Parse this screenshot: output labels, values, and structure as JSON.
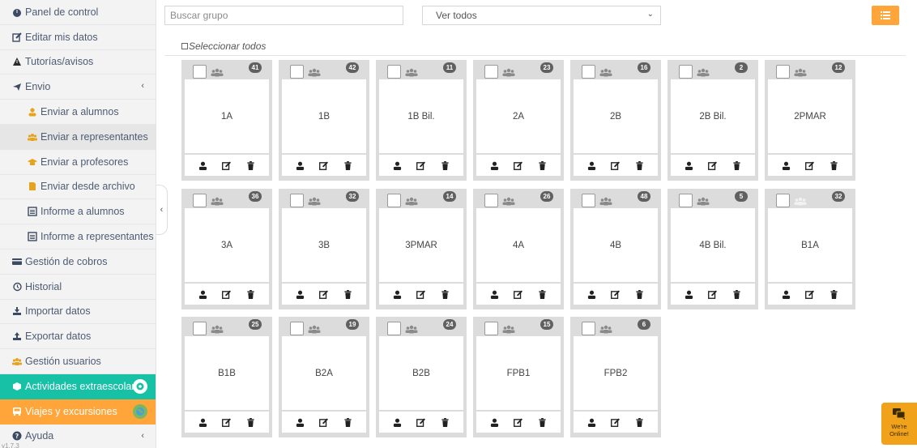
{
  "sidebar": {
    "items": [
      {
        "label": "Panel de control",
        "icon": "dashboard-icon",
        "name": "sidebar-item-panel-control"
      },
      {
        "label": "Editar mis datos",
        "icon": "edit-icon",
        "name": "sidebar-item-editar-datos"
      },
      {
        "label": "Tutorías/avisos",
        "icon": "warning-icon",
        "name": "sidebar-item-tutorias"
      },
      {
        "label": "Envio",
        "icon": "send-icon",
        "name": "sidebar-item-envio",
        "caret": "‹"
      },
      {
        "label": "Enviar a alumnos",
        "icon": "user-icon",
        "name": "sidebar-item-enviar-alumnos",
        "sub": true
      },
      {
        "label": "Enviar a representantes",
        "icon": "users-icon",
        "name": "sidebar-item-enviar-representantes",
        "sub": true,
        "active": true
      },
      {
        "label": "Enviar a profesores",
        "icon": "graduation-cap-icon",
        "name": "sidebar-item-enviar-profesores",
        "sub": true
      },
      {
        "label": "Enviar desde archivo",
        "icon": "file-icon",
        "name": "sidebar-item-enviar-archivo",
        "sub": true
      },
      {
        "label": "Informe a alumnos",
        "icon": "list-alt-icon",
        "name": "sidebar-item-informe-alumnos",
        "sub": true
      },
      {
        "label": "Informe a representantes",
        "icon": "list-alt-icon",
        "name": "sidebar-item-informe-representantes",
        "sub": true
      },
      {
        "label": "Gestión de cobros",
        "icon": "credit-card-icon",
        "name": "sidebar-item-gestion-cobros"
      },
      {
        "label": "Historial",
        "icon": "history-icon",
        "name": "sidebar-item-historial"
      },
      {
        "label": "Importar datos",
        "icon": "import-icon",
        "name": "sidebar-item-importar"
      },
      {
        "label": "Exportar datos",
        "icon": "export-icon",
        "name": "sidebar-item-exportar"
      },
      {
        "label": "Gestión usuarios",
        "icon": "users-icon",
        "name": "sidebar-item-gestion-usuarios"
      },
      {
        "label": "Actividades extraescolares",
        "icon": "cube-icon",
        "name": "sidebar-item-actividades",
        "style": "green"
      },
      {
        "label": "Viajes y excursiones",
        "icon": "bus-icon",
        "name": "sidebar-item-viajes",
        "style": "orange"
      },
      {
        "label": "Ayuda",
        "icon": "help-icon",
        "name": "sidebar-item-ayuda",
        "caret": "‹"
      }
    ],
    "version": "v1.7.3"
  },
  "search": {
    "placeholder": "Buscar grupo"
  },
  "filter": {
    "selected": "Ver todos"
  },
  "select_all_label": "Seleccionar todos",
  "groups": [
    {
      "name": "1A",
      "count": "41"
    },
    {
      "name": "1B",
      "count": "42"
    },
    {
      "name": "1B Bil.",
      "count": "11"
    },
    {
      "name": "2A",
      "count": "23"
    },
    {
      "name": "2B",
      "count": "16"
    },
    {
      "name": "2B Bil.",
      "count": "2"
    },
    {
      "name": "2PMAR",
      "count": "12"
    },
    {
      "name": "3A",
      "count": "36"
    },
    {
      "name": "3B",
      "count": "32"
    },
    {
      "name": "3PMAR",
      "count": "14"
    },
    {
      "name": "4A",
      "count": "26"
    },
    {
      "name": "4B",
      "count": "48"
    },
    {
      "name": "4B Bil.",
      "count": "5"
    },
    {
      "name": "B1A",
      "count": "32"
    },
    {
      "name": "B1B",
      "count": "25"
    },
    {
      "name": "B2A",
      "count": "19"
    },
    {
      "name": "B2B",
      "count": "24"
    },
    {
      "name": "FPB1",
      "count": "15"
    },
    {
      "name": "FPB2",
      "count": "6"
    }
  ],
  "chat": {
    "line1": "We're",
    "line2": "Online!"
  },
  "colors": {
    "accent_orange": "#ffa53a",
    "accent_green": "#16c1a6",
    "sidebar_text": "#4e5b73",
    "card_bg": "#dcdcdc"
  }
}
